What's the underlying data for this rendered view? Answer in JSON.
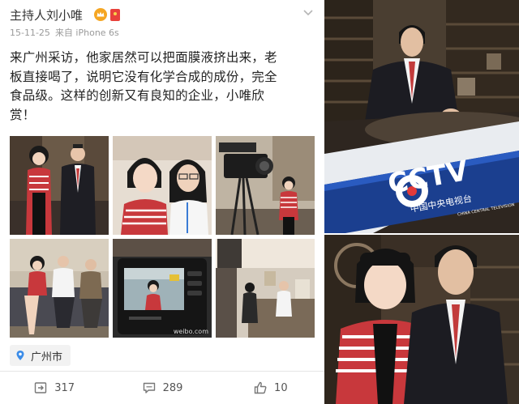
{
  "post": {
    "author": "主持人刘小唯",
    "meta": {
      "date": "15-11-25",
      "source": "来自 iPhone 6s"
    },
    "lines": [
      "来广州采访，他家居然可以把面膜液挤出来，老",
      "板直接喝了，说明它没有化学合成的成份，完全",
      "食品级。这样的创新又有良知的企业，小唯欣",
      "赏！"
    ],
    "location": "广州市",
    "stats": {
      "reposts": "317",
      "comments": "289",
      "likes": "10"
    },
    "watermark": "weibo.com"
  },
  "side": {
    "logo_text": "CCTV",
    "logo_cn": "中国中央电视台",
    "logo_en": "CHINA CENTRAL TELEVISION"
  },
  "colors": {
    "cctv_blue": "#1b3f8f",
    "weibo_red": "#e8413b",
    "pin_blue": "#3b8ce8"
  }
}
